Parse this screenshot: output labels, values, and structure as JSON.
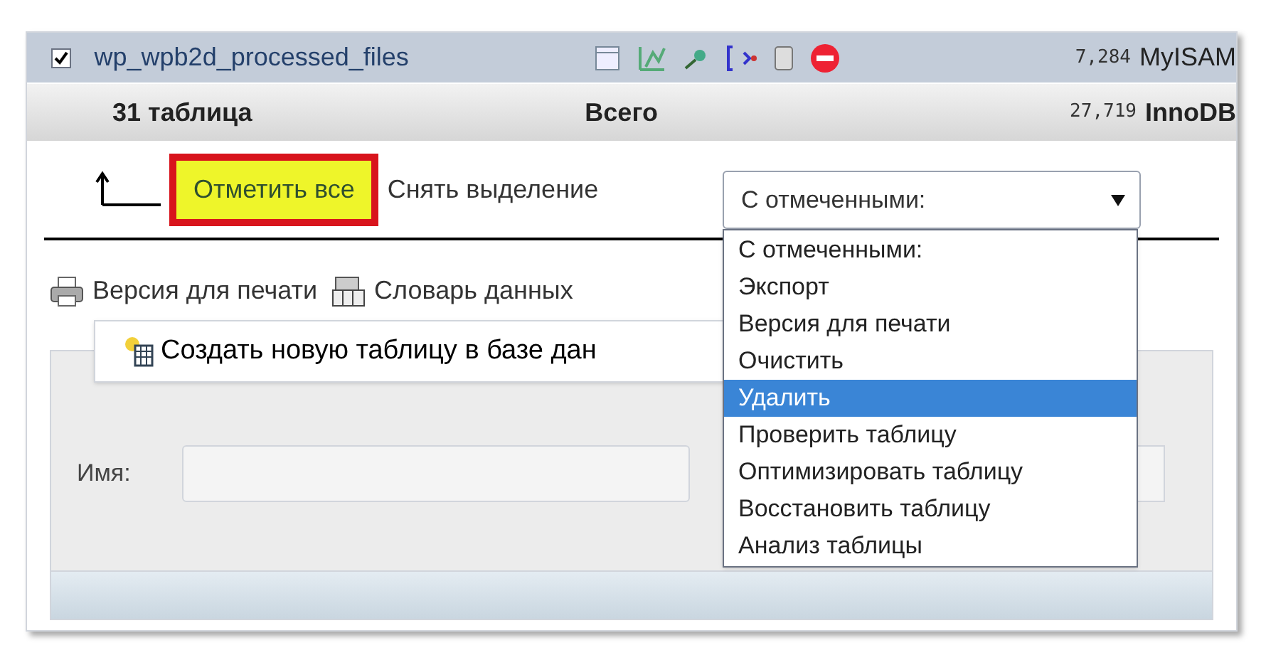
{
  "table": {
    "rows": [
      {
        "kind": "table",
        "checked": true,
        "name": "wp_wpb2d_processed_files",
        "rows": "7,284",
        "engine": "MyISAM"
      },
      {
        "kind": "summary",
        "name": "31 таблица",
        "label": "Всего",
        "rows": "27,719",
        "engine": "InnoDB"
      }
    ]
  },
  "selection": {
    "check_all": "Отметить все",
    "uncheck_all": "Снять выделение"
  },
  "with_selected": {
    "value": "С отмеченными:",
    "options": [
      {
        "label": "С отмеченными:",
        "highlighted": false
      },
      {
        "label": "Экспорт",
        "highlighted": false
      },
      {
        "label": "Версия для печати",
        "highlighted": false
      },
      {
        "label": "Очистить",
        "highlighted": false
      },
      {
        "label": "Удалить",
        "highlighted": true
      },
      {
        "label": "Проверить таблицу",
        "highlighted": false
      },
      {
        "label": "Оптимизировать таблицу",
        "highlighted": false
      },
      {
        "label": "Восстановить таблицу",
        "highlighted": false
      },
      {
        "label": "Анализ таблицы",
        "highlighted": false
      }
    ]
  },
  "links": [
    "Версия для печати",
    "Словарь данных"
  ],
  "create_table": {
    "legend": "Создать новую таблицу в базе дан",
    "name_label": "Имя:"
  }
}
